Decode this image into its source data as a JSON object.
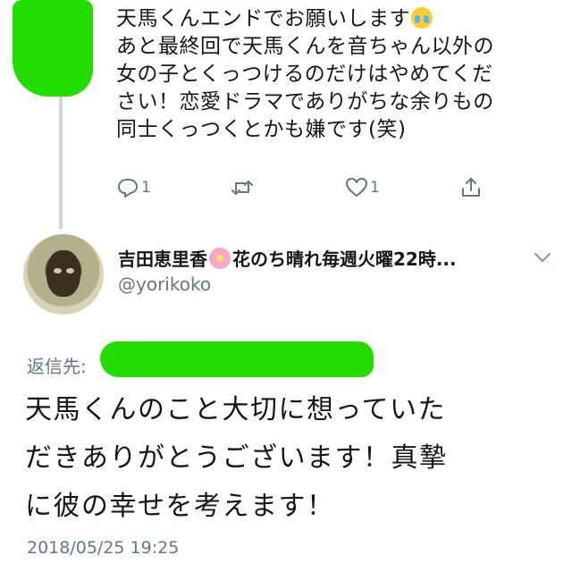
{
  "parent_tweet": {
    "lines": [
      "天馬くんエンドでお願いします",
      "あと最終回で天馬くんを音ちゃん以外の",
      "女の子とくっつけるのだけはやめてくだ",
      "さい！恋愛ドラマでありがちな余りもの",
      "同士くっつくとかも嫌です(笑)"
    ],
    "emoji": "loudly-crying-face",
    "actions": {
      "reply_count": "1",
      "retweet_count": "",
      "like_count": "1"
    }
  },
  "reply": {
    "author_name": "吉田恵里香",
    "author_name_suffix": "花のち晴れ毎週火曜22時...",
    "author_emoji": "cherry-blossom",
    "handle": "@yorikoko",
    "reply_to_label": "返信先:",
    "text_lines": [
      "天馬くんのこと大切に想っていた",
      "だきありがとうございます！真摯",
      "に彼の幸せを考えます！"
    ],
    "timestamp": "2018/05/25 19:25"
  },
  "colors": {
    "redaction": "#22dd00",
    "muted": "#657786",
    "thread_line": "#ccd6dd"
  }
}
